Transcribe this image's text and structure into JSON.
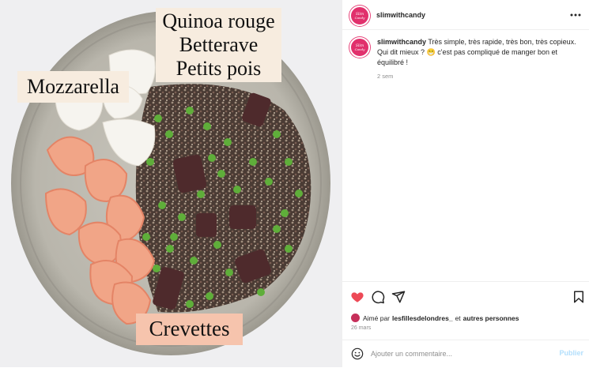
{
  "post": {
    "username": "slimwithcandy",
    "avatar_text": "Slim with Candy",
    "more_icon": "more-horizontal-icon",
    "caption": {
      "text": "Très simple, très rapide, très bon, très copieux. Qui dit mieux ? 😁 c'est pas compliqué de manger bon et équilibré !",
      "time": "2 sem"
    },
    "likes": {
      "prefix": "Aimé par",
      "user": "lesfillesdelondres_",
      "middle": "et",
      "suffix": "autres personnes"
    },
    "date": "26 mars"
  },
  "photo": {
    "labels": {
      "quinoa": [
        "Quinoa rouge",
        "Betterave",
        "Petits pois"
      ],
      "mozzarella": "Mozzarella",
      "crevettes": "Crevettes"
    }
  },
  "actions": {
    "like_icon": "heart-filled-icon",
    "comment_icon": "comment-icon",
    "share_icon": "paper-plane-icon",
    "save_icon": "bookmark-icon",
    "like_color": "#ed4956"
  },
  "comment": {
    "placeholder": "Ajouter un commentaire...",
    "publish_label": "Publier",
    "emoji_icon": "smiley-icon"
  },
  "colors": {
    "accent_brand": "#e1306c",
    "publish_disabled": "#b2dffc",
    "label_bg": "#f7ecdf",
    "crevettes_label_bg": "#f6c4ad"
  }
}
